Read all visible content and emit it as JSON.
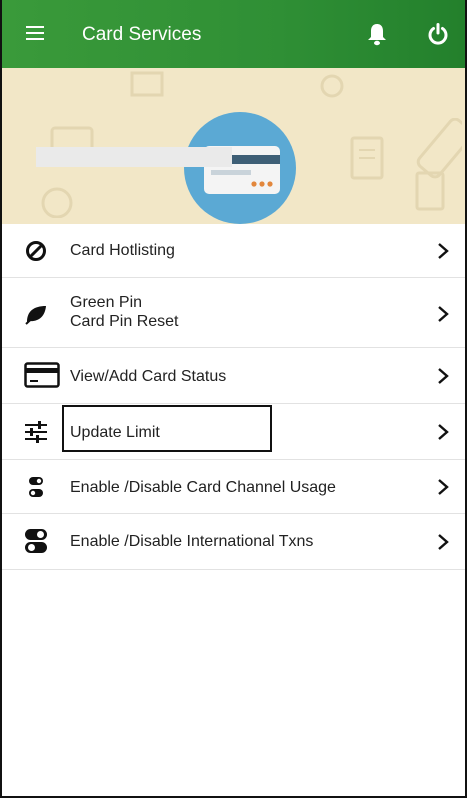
{
  "header": {
    "title": "Card Services",
    "menu_icon": "hamburger-menu-icon",
    "notification_icon": "bell-icon",
    "power_icon": "power-icon",
    "bar_color": "#2f8f35"
  },
  "banner": {
    "background_color": "#f2e7c7",
    "illustration": "credit-card-icon"
  },
  "menu": {
    "items": [
      {
        "label": "Card Hotlisting",
        "icon": "block-icon"
      },
      {
        "line1": "Green Pin",
        "line2": "Card Pin Reset",
        "icon": "leaf-icon"
      },
      {
        "label": "View/Add Card Status",
        "icon": "card-icon"
      },
      {
        "label": "Update Limit",
        "icon": "sliders-icon"
      },
      {
        "label": "Enable /Disable Card Channel Usage",
        "icon": "toggle-small-icon"
      },
      {
        "label": "Enable /Disable International Txns",
        "icon": "toggle-large-icon"
      }
    ]
  }
}
